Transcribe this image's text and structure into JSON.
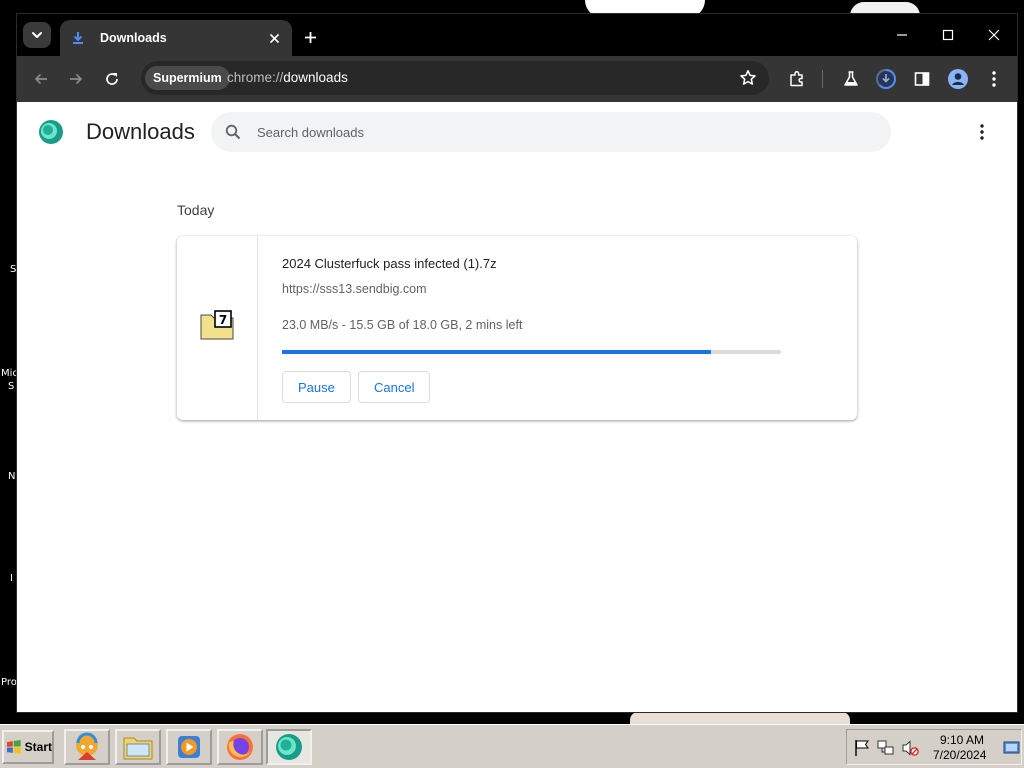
{
  "browser": {
    "tab": {
      "title": "Downloads"
    },
    "omnibox": {
      "chip": "Supermium",
      "url_prefix": "chrome://",
      "url_host": "downloads"
    }
  },
  "page": {
    "title": "Downloads",
    "search_placeholder": "Search downloads",
    "section_label": "Today",
    "download": {
      "filename": "2024 Clusterfuck pass infected (1).7z",
      "source": "https://sss13.sendbig.com",
      "status": "23.0 MB/s - 15.5 GB of 18.0 GB, 2 mins left",
      "progress_fraction": 0.86,
      "pause_label": "Pause",
      "cancel_label": "Cancel"
    }
  },
  "desktop": {
    "fragments": [
      "S",
      "Mic",
      "S",
      "N",
      "I",
      "Pro"
    ]
  },
  "taskbar": {
    "start_label": "Start",
    "items": [
      "winamp-icon",
      "folder-icon",
      "media-player-icon",
      "firefox-icon",
      "supermium-icon"
    ],
    "clock_time": "9:10 AM",
    "clock_date": "7/20/2024"
  },
  "colors": {
    "accent": "#1a73e8",
    "tab_bg": "#353535",
    "taskbar": "#d4d0c8"
  }
}
